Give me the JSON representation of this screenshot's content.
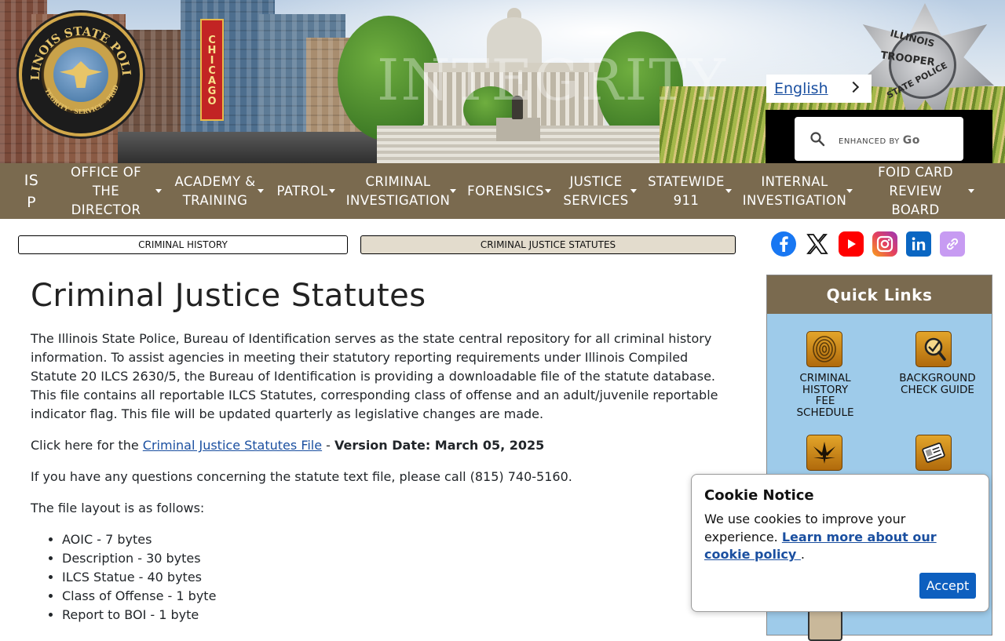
{
  "banner": {
    "watermark": "INTEGRITY",
    "chicago_sign": "CHICAGO",
    "seal_text": "ILLINOIS STATE POLICE",
    "seal_motto": "INTEGRITY · SERVICE · PRIDE",
    "badge_top": "ILLINOIS",
    "badge_middle": "TROOPER",
    "badge_bottom": "STATE POLICE"
  },
  "language": {
    "label": "English"
  },
  "search": {
    "enhanced_by": "ENHANCED BY",
    "brand": "Go"
  },
  "nav": {
    "items": [
      {
        "label": "IS\nP"
      },
      {
        "label": "OFFICE OF\nTHE\nDIRECTOR"
      },
      {
        "label": "ACADEMY &\nTRAINING"
      },
      {
        "label": "PATROL"
      },
      {
        "label": "CRIMINAL\nINVESTIGATION"
      },
      {
        "label": "FORENSICS"
      },
      {
        "label": "JUSTICE\nSERVICES"
      },
      {
        "label": "STATEWIDE\n911"
      },
      {
        "label": "INTERNAL\nINVESTIGATION"
      },
      {
        "label": "FOID CARD\nREVIEW\nBOARD"
      }
    ]
  },
  "tabs": [
    {
      "label": "CRIMINAL HISTORY"
    },
    {
      "label": "CRIMINAL JUSTICE STATUTES"
    }
  ],
  "social": {
    "icons": [
      "facebook-icon",
      "x-icon",
      "youtube-icon",
      "instagram-icon",
      "linkedin-icon",
      "link-icon"
    ],
    "colors": {
      "facebook": "#1877f2",
      "youtube": "#ff0000",
      "linkedin": "#0a66c2",
      "link": "#c79bf2"
    }
  },
  "main": {
    "title": "Criminal Justice Statutes",
    "intro": "The Illinois State Police, Bureau of Identification serves as the state central repository for all criminal history information. To assist agencies in meeting their statutory reporting requirements under Illinois Compiled Statute 20 ILCS 2630/5, the Bureau of Identification is providing a downloadable file of the statute database. This file contains all reportable ILCS Statutes, corresponding class of offense and an adult/juvenile reportable indicator flag. This file will be updated quarterly as legislative changes are made.",
    "click_prefix": "Click here for the ",
    "file_link": "Criminal Justice Statutes File",
    "dash": " - ",
    "version": "Version Date: March 05, 2025",
    "questions": "If you have any questions concerning the statute text file, please call (815) 740-5160.",
    "layout_intro": "The file layout is as follows:",
    "layout_items": [
      "AOIC - 7 bytes",
      "Description - 30 bytes",
      "ILCS Statue - 40 bytes",
      "Class of Offense - 1 byte",
      "Report to BOI - 1 byte"
    ]
  },
  "quick_links": {
    "title": "Quick Links",
    "items": [
      {
        "label": "CRIMINAL\nHISTORY\nFEE\nSCHEDULE",
        "icon": "fingerprint-icon"
      },
      {
        "label": "BACKGROUND\nCHECK GUIDE",
        "icon": "magnifier-check-icon"
      },
      {
        "label": "",
        "icon": "cannabis-leaf-icon"
      },
      {
        "label": "",
        "icon": "id-card-icon"
      }
    ]
  },
  "cookie": {
    "title": "Cookie Notice",
    "text": "We use cookies to improve your experience. ",
    "link": "Learn more about our cookie policy ",
    "period": ".",
    "accept": "Accept"
  },
  "colors": {
    "nav_bg": "#7a6a4f",
    "quick_links_bg": "#9ecbea",
    "active_tab_bg": "#e3dccd",
    "link": "#1a4fa0",
    "accept_button": "#0d5fbf"
  }
}
